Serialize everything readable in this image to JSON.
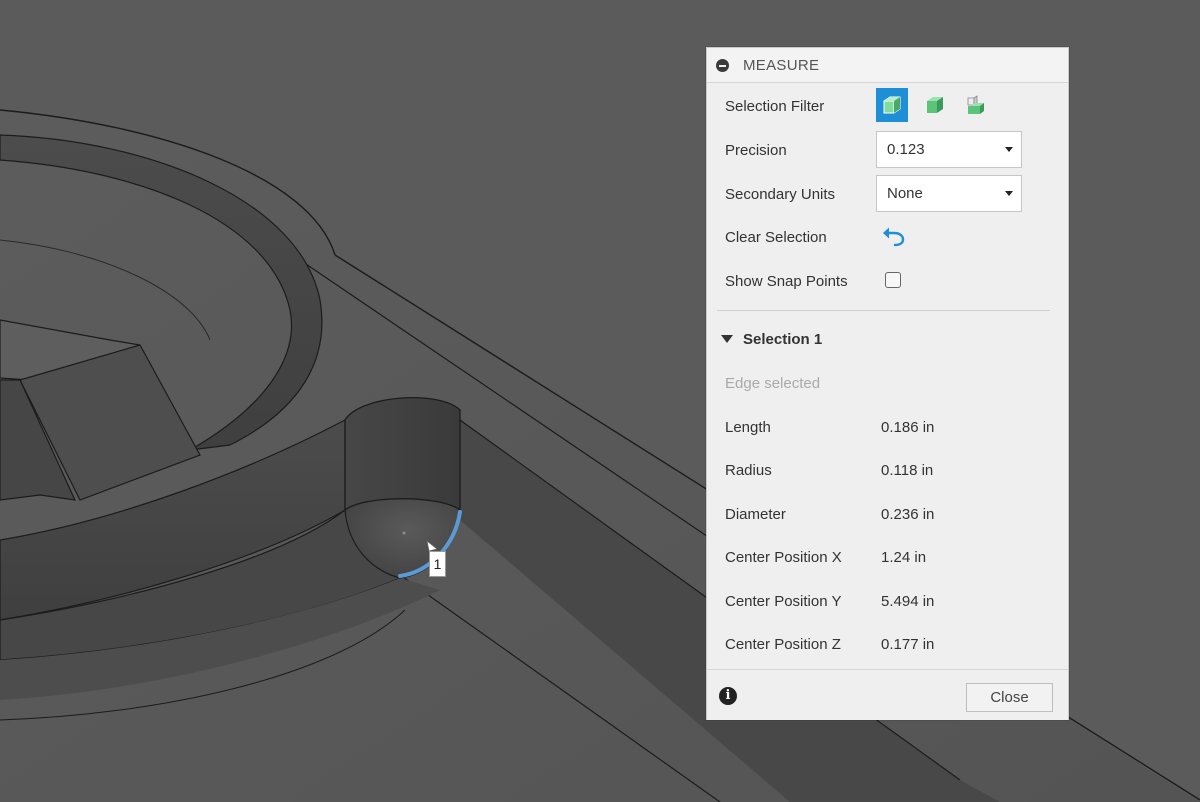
{
  "viewport": {
    "marker_label": "1"
  },
  "panel": {
    "title": "MEASURE",
    "selection_filter": {
      "label": "Selection Filter",
      "buttons": [
        {
          "icon": "body-filter-icon",
          "active": true
        },
        {
          "icon": "face-filter-icon",
          "active": false
        },
        {
          "icon": "component-filter-icon",
          "active": false
        }
      ]
    },
    "precision": {
      "label": "Precision",
      "value": "0.123"
    },
    "secondary_units": {
      "label": "Secondary Units",
      "value": "None"
    },
    "clear_selection": {
      "label": "Clear Selection",
      "icon": "undo-arrow-icon"
    },
    "show_snap_points": {
      "label": "Show Snap Points",
      "checked": false
    },
    "selection": {
      "title": "Selection 1",
      "status": "Edge selected",
      "rows": [
        {
          "label": "Length",
          "value": "0.186 in"
        },
        {
          "label": "Radius",
          "value": "0.118 in"
        },
        {
          "label": "Diameter",
          "value": "0.236 in"
        },
        {
          "label": "Center Position X",
          "value": "1.24 in"
        },
        {
          "label": "Center Position Y",
          "value": "5.494 in"
        },
        {
          "label": "Center Position Z",
          "value": "0.177 in"
        }
      ]
    },
    "footer": {
      "info_icon": "info-icon",
      "close_label": "Close"
    }
  },
  "colors": {
    "accent": "#1e8fd6",
    "cube_green": "#5ac47a",
    "selected_edge": "#5b9bd5",
    "viewport_bg": "#595959"
  }
}
